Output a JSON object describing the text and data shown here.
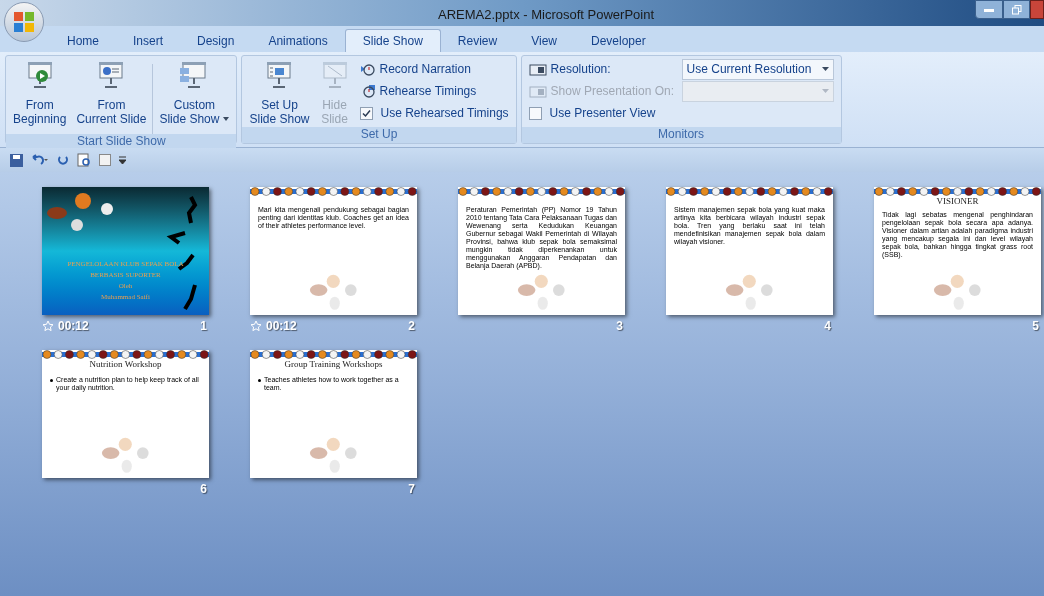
{
  "window": {
    "title": "AREMA2.pptx - Microsoft PowerPoint"
  },
  "tabs": [
    {
      "label": "Home",
      "selected": false
    },
    {
      "label": "Insert",
      "selected": false
    },
    {
      "label": "Design",
      "selected": false
    },
    {
      "label": "Animations",
      "selected": false
    },
    {
      "label": "Slide Show",
      "selected": true
    },
    {
      "label": "Review",
      "selected": false
    },
    {
      "label": "View",
      "selected": false
    },
    {
      "label": "Developer",
      "selected": false
    }
  ],
  "ribbon": [
    {
      "label": "Start Slide Show",
      "items": [
        {
          "kind": "big",
          "lines": [
            "From",
            "Beginning"
          ],
          "disabled": false
        },
        {
          "kind": "big",
          "lines": [
            "From",
            "Current Slide"
          ],
          "disabled": false
        },
        {
          "kind": "separator"
        },
        {
          "kind": "big",
          "lines": [
            "Custom",
            "Slide Show"
          ],
          "disabled": false,
          "menu": true
        }
      ]
    },
    {
      "label": "Set Up",
      "items": [
        {
          "kind": "big",
          "lines": [
            "Set Up",
            "Slide Show"
          ],
          "disabled": false
        },
        {
          "kind": "big",
          "lines": [
            "Hide",
            "Slide"
          ],
          "disabled": true
        },
        {
          "kind": "stack",
          "rows": [
            {
              "kind": "small",
              "label": "Record Narration"
            },
            {
              "kind": "small",
              "label": "Rehearse Timings"
            },
            {
              "kind": "checkbox",
              "label": "Use Rehearsed Timings",
              "checked": true
            }
          ]
        }
      ]
    },
    {
      "label": "Monitors",
      "items": [
        {
          "kind": "stack",
          "rows": [
            {
              "kind": "dropdown",
              "label": "Resolution:",
              "value": "Use Current Resolution",
              "disabled": false
            },
            {
              "kind": "dropdown",
              "label": "Show Presentation On:",
              "disabled": true
            },
            {
              "kind": "checkbox",
              "label": "Use Presenter View",
              "checked": false
            }
          ]
        }
      ]
    }
  ],
  "slides": [
    {
      "number": "1",
      "kind": "cover",
      "timing": "00:12",
      "lines": [
        "PENGELOLAAN KLUB SEPAK BOLA",
        "BERBASIS SUPORTER",
        "Oleh",
        "Muhammad Saifi"
      ]
    },
    {
      "number": "2",
      "kind": "content",
      "timing": "00:12",
      "body": "Mari kita mengenali pendukung sebagai bagian penting dari identitas klub. Coaches get an idea of their athletes performance level."
    },
    {
      "number": "3",
      "kind": "content",
      "body": "Peraturan Pemerintah (PP) Nomor 19 Tahun 2010 tentang Tata Cara Pelaksanaan Tugas dan Wewenang serta Kedudukan Keuangan Gubernur sebagai Wakil Pemerintah di Wilayah Provinsi, bahwa klub sepak bola semaksimal mungkin tidak diperkenankan untuk menggunakan Anggaran Pendapatan dan Belanja Daerah (APBD)."
    },
    {
      "number": "4",
      "kind": "content",
      "body": "Sistem manajemen sepak bola yang kuat maka artinya kita berbicara wilayah industri sepak bola. Tren yang berlaku saat ini telah mendefinisikan manajemen sepak bola dalam wilayah visioner."
    },
    {
      "number": "5",
      "kind": "content",
      "title": "VISIONER",
      "body": "Tidak lagi sebatas mengenal penghindaran pengelolaan sepak bola secara apa adanya. Visioner dalam artian adalah paradigma industri yang mencakup segala ini dan level wilayah sepak bola, bahkan hingga tingkat grass root (SSB)."
    },
    {
      "number": "6",
      "kind": "bullets",
      "title": "Nutrition Workshop",
      "bullets": [
        "Create a nutrition plan to help keep track of all your daily nutrition."
      ]
    },
    {
      "number": "7",
      "kind": "bullets",
      "title": "Group Training Workshops",
      "bullets": [
        "Teaches athletes how to work together as a team."
      ]
    }
  ]
}
